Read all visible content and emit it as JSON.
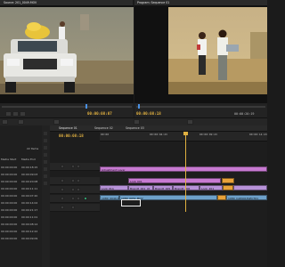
{
  "colors": {
    "accent": "#e0b040",
    "pink_clip": "#c77ad1",
    "violet_clip": "#b792d8",
    "blue_clip": "#6ea1ca",
    "orange_clip": "#e8a23a"
  },
  "source_monitor": {
    "tab": "Source: 201_0049.MOV",
    "timecode": "00:00:08:07",
    "duration": ""
  },
  "program_monitor": {
    "tab": "Program: Sequence 01",
    "timecode": "00:00:08:18",
    "duration": "00:00:20:19"
  },
  "project": {
    "item_count": "22 Items",
    "col_start": "Media Start",
    "col_end": "Media End",
    "rows": [
      {
        "start": "00:00:00:00",
        "end": "00:00:18:15"
      },
      {
        "start": "00:00:00:00",
        "end": "00:00:09:03"
      },
      {
        "start": "00:00:00:00",
        "end": "00:00:20:08"
      },
      {
        "start": "00:00:00:00",
        "end": "00:00:11:11"
      },
      {
        "start": "00:00:00:00",
        "end": "00:00:07:20"
      },
      {
        "start": "00:00:00:00",
        "end": "00:00:14:02"
      },
      {
        "start": "00:00:00:00",
        "end": "00:00:21:17"
      },
      {
        "start": "00:00:00:00",
        "end": "00:00:11:01"
      },
      {
        "start": "00:00:00:00",
        "end": "00:00:08:14"
      },
      {
        "start": "00:00:00:00",
        "end": "00:00:12:22"
      },
      {
        "start": "00:00:00:00",
        "end": "00:00:09:09"
      }
    ]
  },
  "timeline": {
    "tab_active": "Sequence 01",
    "tab_2": "Sequence 02",
    "tab_3": "Sequence 03",
    "timecode": "00:00:08:18",
    "ruler": [
      "00:00",
      "00:00:04:23",
      "00:00:09:23",
      "00:00:14:23"
    ],
    "clips": {
      "v3": "Adjustment Layer",
      "v2a": "Look 001",
      "v1a": "Look 01A",
      "v1b": "Brandt_001_Ut",
      "v1c": "Brandt_005",
      "v1d": "Brandt_006",
      "v1e": "Look_201",
      "a1a": "1080_0049.MOV",
      "a1b": "1080_0051.MOV",
      "a1c": "1080_CAP001ELECT01"
    }
  },
  "icons": [
    "play-icon",
    "step-back-icon",
    "step-forward-icon",
    "selection-tool-icon",
    "razor-tool-icon",
    "lock-icon",
    "eye-icon",
    "speaker-icon"
  ]
}
